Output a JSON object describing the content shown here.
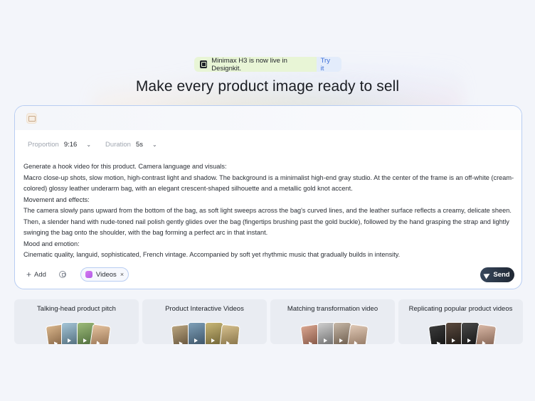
{
  "announcement": {
    "text": "Minimax H3 is now live in Designkit.",
    "cta": "Try it"
  },
  "headline": "Make every product image ready to sell",
  "composer": {
    "params": [
      {
        "label": "Proportion",
        "value": "9:16"
      },
      {
        "label": "Duration",
        "value": "5s"
      }
    ],
    "prompt_lines": [
      "Generate a hook video for this product. Camera language and visuals:",
      "Macro close-up shots, slow motion, high-contrast light and shadow. The background is a minimalist high-end gray studio. At the center of the frame is an off-white (cream-",
      "colored) glossy leather underarm bag, with an elegant crescent-shaped silhouette and a metallic gold knot accent.",
      "Movement and effects:",
      "The camera slowly pans upward from the bottom of the bag, as soft light sweeps across the bag's curved lines, and the leather surface reflects a creamy, delicate sheen.",
      "Then, a slender hand with nude-toned nail polish gently glides over the bag (fingertips brushing past the gold buckle), followed by the hand grasping the strap and lightly",
      "swinging the bag onto the shoulder, with the bag forming a perfect arc in that instant.",
      "Mood and emotion:",
      "Cinematic quality, languid, sophisticated, French vintage. Accompanied by soft yet rhythmic music that gradually builds in intensity."
    ],
    "add_label": "Add",
    "chip_label": "Videos",
    "send_label": "Send"
  },
  "cards": [
    {
      "title": "Talking-head product pitch"
    },
    {
      "title": "Product Interactive Videos"
    },
    {
      "title": "Matching transformation video"
    },
    {
      "title": "Replicating popular product videos"
    }
  ],
  "colors": {
    "accent": "#3d6fd8",
    "composer_border": "#b8cdf2",
    "send_bg": "#1f2733"
  }
}
